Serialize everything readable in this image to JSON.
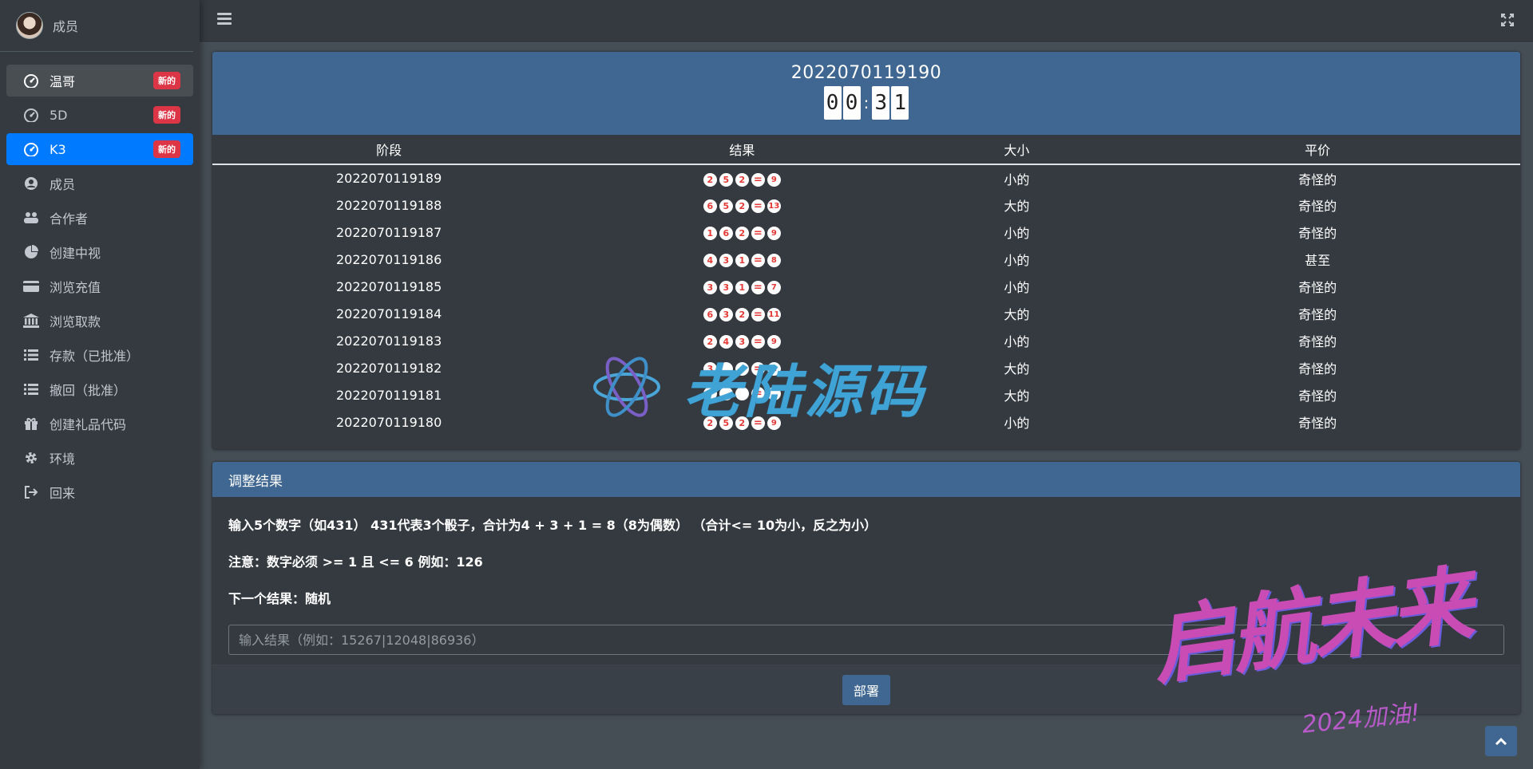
{
  "user": {
    "name": "成员"
  },
  "sidebar": {
    "items": [
      {
        "label": "温哥",
        "badge": "新的",
        "icon": "dashboard-icon"
      },
      {
        "label": "5D",
        "badge": "新的",
        "icon": "dashboard-icon"
      },
      {
        "label": "K3",
        "badge": "新的",
        "icon": "dashboard-icon"
      },
      {
        "label": "成员",
        "icon": "user-circle-icon"
      },
      {
        "label": "合作者",
        "icon": "users-icon"
      },
      {
        "label": "创建中视",
        "icon": "pie-chart-icon"
      },
      {
        "label": "浏览充值",
        "icon": "credit-card-icon"
      },
      {
        "label": "浏览取款",
        "icon": "bank-icon"
      },
      {
        "label": "存款（已批准）",
        "icon": "list-icon"
      },
      {
        "label": "撤回（批准）",
        "icon": "list-icon"
      },
      {
        "label": "创建礼品代码",
        "icon": "gift-icon"
      },
      {
        "label": "环境",
        "icon": "gear-icon"
      },
      {
        "label": "回来",
        "icon": "sign-out-icon"
      }
    ]
  },
  "results": {
    "period": "2022070119190",
    "timer": [
      "0",
      "0",
      "3",
      "1"
    ],
    "headers": [
      "阶段",
      "结果",
      "大小",
      "平价"
    ],
    "rows": [
      {
        "period": "2022070119189",
        "dice": [
          "2",
          "5",
          "2"
        ],
        "sum": "9",
        "size": "小的",
        "parity": "奇怪的"
      },
      {
        "period": "2022070119188",
        "dice": [
          "6",
          "5",
          "2"
        ],
        "sum": "13",
        "size": "大的",
        "parity": "奇怪的"
      },
      {
        "period": "2022070119187",
        "dice": [
          "1",
          "6",
          "2"
        ],
        "sum": "9",
        "size": "小的",
        "parity": "奇怪的"
      },
      {
        "period": "2022070119186",
        "dice": [
          "4",
          "3",
          "1"
        ],
        "sum": "8",
        "size": "小的",
        "parity": "甚至"
      },
      {
        "period": "2022070119185",
        "dice": [
          "3",
          "3",
          "1"
        ],
        "sum": "7",
        "size": "小的",
        "parity": "奇怪的"
      },
      {
        "period": "2022070119184",
        "dice": [
          "6",
          "3",
          "2"
        ],
        "sum": "11",
        "size": "大的",
        "parity": "奇怪的"
      },
      {
        "period": "2022070119183",
        "dice": [
          "2",
          "4",
          "3"
        ],
        "sum": "9",
        "size": "小的",
        "parity": "奇怪的"
      },
      {
        "period": "2022070119182",
        "dice": [
          "3",
          "",
          ""
        ],
        "sum": "1",
        "size": "大的",
        "parity": "奇怪的"
      },
      {
        "period": "2022070119181",
        "dice": [
          "",
          "",
          ""
        ],
        "sum": "",
        "size": "大的",
        "parity": "奇怪的"
      },
      {
        "period": "2022070119180",
        "dice": [
          "2",
          "5",
          "2"
        ],
        "sum": "9",
        "size": "小的",
        "parity": "奇怪的"
      }
    ]
  },
  "adjust": {
    "title": "调整结果",
    "line1": "输入5个数字（如431） 431代表3个骰子，合计为4 + 3 + 1 = 8（8为偶数） （合计<= 10为小，反之为小）",
    "line2": "注意：数字必须 >= 1 且 <= 6 例如：126",
    "line3": "下一个结果：随机",
    "placeholder": "输入结果（例如：15267|12048|86936）",
    "deploy_label": "部署"
  },
  "watermarks": {
    "center": "老陆源码",
    "corner_big": "启航未来",
    "corner_small": "2024加油!"
  },
  "colors": {
    "accent": "#007bff",
    "header": "#3f6791",
    "badge": "#dc3545",
    "die": "#e53935"
  }
}
